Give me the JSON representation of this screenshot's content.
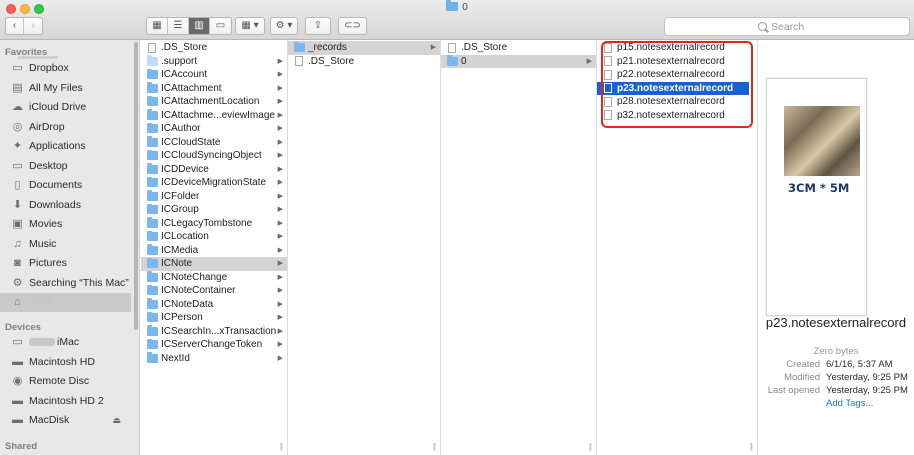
{
  "window": {
    "title": "0"
  },
  "toolbar": {
    "back_glyph": "‹",
    "forward_glyph": "›",
    "view_icon_glyph": "▦",
    "view_list_glyph": "☰",
    "view_column_glyph": "▥",
    "view_cover_glyph": "▭",
    "group_glyph": "▦ ▾",
    "action_glyph": "⚙ ▾",
    "share_glyph": "⇪",
    "tag_glyph": "⊂⊃"
  },
  "search": {
    "placeholder": "Search"
  },
  "sidebar": {
    "favorites_header": "Favorites",
    "favorites": [
      {
        "label": "Dropbox",
        "icon": "dropbox-icon",
        "glyph": "▭"
      },
      {
        "label": "All My Files",
        "icon": "all-files-icon",
        "glyph": "▤"
      },
      {
        "label": "iCloud Drive",
        "icon": "icloud-icon",
        "glyph": "☁"
      },
      {
        "label": "AirDrop",
        "icon": "airdrop-icon",
        "glyph": "◎"
      },
      {
        "label": "Applications",
        "icon": "applications-icon",
        "glyph": "✦"
      },
      {
        "label": "Desktop",
        "icon": "desktop-icon",
        "glyph": "▭"
      },
      {
        "label": "Documents",
        "icon": "documents-icon",
        "glyph": "▯"
      },
      {
        "label": "Downloads",
        "icon": "downloads-icon",
        "glyph": "⬇"
      },
      {
        "label": "Movies",
        "icon": "movies-icon",
        "glyph": "▣"
      },
      {
        "label": "Music",
        "icon": "music-icon",
        "glyph": "♫"
      },
      {
        "label": "Pictures",
        "icon": "pictures-icon",
        "glyph": "◙"
      },
      {
        "label": "Searching “This Mac”",
        "icon": "gear-icon",
        "glyph": "⚙"
      },
      {
        "label": "",
        "icon": "home-icon",
        "glyph": "⌂"
      }
    ],
    "devices_header": "Devices",
    "devices": [
      {
        "label": "iMac",
        "icon": "imac-icon",
        "glyph": "▭"
      },
      {
        "label": "Macintosh HD",
        "icon": "hard-drive-icon",
        "glyph": "▬"
      },
      {
        "label": "Remote Disc",
        "icon": "disc-icon",
        "glyph": "◉"
      },
      {
        "label": "Macintosh HD 2",
        "icon": "hard-drive-icon",
        "glyph": "▬"
      },
      {
        "label": "MacDisk",
        "icon": "hard-drive-icon",
        "glyph": "▬",
        "eject": "⏏"
      }
    ],
    "shared_header": "Shared"
  },
  "column1": [
    {
      "label": ".DS_Store",
      "type": "doc"
    },
    {
      "label": ".support",
      "type": "folder-pale"
    },
    {
      "label": "ICAccount",
      "type": "folder"
    },
    {
      "label": "ICAttachment",
      "type": "folder"
    },
    {
      "label": "ICAttachmentLocation",
      "type": "folder"
    },
    {
      "label": "ICAttachme...eviewImage",
      "type": "folder"
    },
    {
      "label": "ICAuthor",
      "type": "folder"
    },
    {
      "label": "ICCloudState",
      "type": "folder"
    },
    {
      "label": "ICCloudSyncingObject",
      "type": "folder"
    },
    {
      "label": "ICDDevice",
      "type": "folder"
    },
    {
      "label": "ICDeviceMigrationState",
      "type": "folder"
    },
    {
      "label": "ICFolder",
      "type": "folder"
    },
    {
      "label": "ICGroup",
      "type": "folder"
    },
    {
      "label": "ICLegacyTombstone",
      "type": "folder"
    },
    {
      "label": "ICLocation",
      "type": "folder"
    },
    {
      "label": "ICMedia",
      "type": "folder"
    },
    {
      "label": "ICNote",
      "type": "folder",
      "selected": true
    },
    {
      "label": "ICNoteChange",
      "type": "folder"
    },
    {
      "label": "ICNoteContainer",
      "type": "folder"
    },
    {
      "label": "ICNoteData",
      "type": "folder"
    },
    {
      "label": "ICPerson",
      "type": "folder"
    },
    {
      "label": "ICSearchIn...xTransaction",
      "type": "folder"
    },
    {
      "label": "ICServerChangeToken",
      "type": "folder"
    },
    {
      "label": "NextId",
      "type": "folder"
    }
  ],
  "column2": [
    {
      "label": "_records",
      "type": "folder",
      "selected": true
    },
    {
      "label": ".DS_Store",
      "type": "doc"
    }
  ],
  "column3": [
    {
      "label": ".DS_Store",
      "type": "doc"
    },
    {
      "label": "0",
      "type": "folder",
      "selected": true
    }
  ],
  "column4": [
    {
      "label": "p15.notesexternalrecord",
      "type": "doc"
    },
    {
      "label": "p21.notesexternalrecord",
      "type": "doc"
    },
    {
      "label": "p22.notesexternalrecord",
      "type": "doc"
    },
    {
      "label": "p23.notesexternalrecord",
      "type": "doc",
      "selected": true
    },
    {
      "label": "p28.notesexternalrecord",
      "type": "doc"
    },
    {
      "label": "p32.notesexternalrecord",
      "type": "doc"
    }
  ],
  "arrow_glyph": "▶",
  "grip_glyph": "||",
  "preview": {
    "thumbnail_caption": "3CM * 5M",
    "name": "p23.notesexternalrecord",
    "size": "Zero bytes",
    "created_label": "Created",
    "created_value": "6/1/16, 5:37 AM",
    "modified_label": "Modified",
    "modified_value": "Yesterday, 9:25 PM",
    "opened_label": "Last opened",
    "opened_value": "Yesterday, 9:25 PM",
    "add_tags": "Add Tags..."
  },
  "colors": {
    "selection_blue": "#1761d5",
    "annotation_red": "#e3261c",
    "folder_blue": "#79b7ee"
  }
}
